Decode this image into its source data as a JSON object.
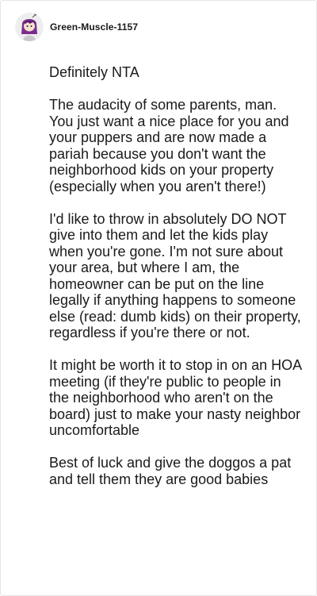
{
  "comment": {
    "author": "Green-Muscle-1157",
    "avatar_icon": "snoo-avatar-icon",
    "paragraphs": [
      "Definitely NTA",
      "The audacity of some parents, man. You just want a nice place for you and your puppers and are now made a pariah because you don't want the neighborhood kids on your property (especially when you aren't there!)",
      "I'd like to throw in absolutely DO NOT give into them and let the kids play when you're gone. I'm not sure about your area, but where I am, the homeowner can be put on the line legally if anything happens to someone else (read: dumb kids) on their property, regardless if you're there or not.",
      "It might be worth it to stop in on an HOA meeting (if they're public to people in the neighborhood who aren't on the board) just to make your nasty neighbor uncomfortable",
      "Best of luck and give the doggos a pat and tell them they are good babies"
    ]
  },
  "colors": {
    "text": "#1a1a1b",
    "avatar_accent": "#7b2d8e",
    "avatar_face": "#f6e2cf"
  }
}
